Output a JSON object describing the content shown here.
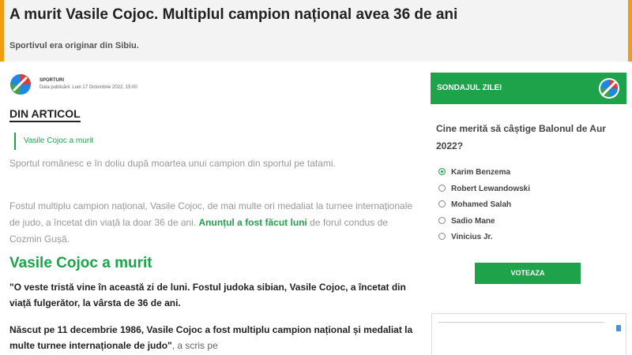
{
  "article": {
    "title": "A murit Vasile Cojoc. Multiplul campion național avea 36 de ani",
    "subtitle": "Sportivul era originar din Sibiu.",
    "author": "SPORTURI",
    "date": "Data publicării: Luni 17 Octombrie 2022, 15:00",
    "din_articol": "DIN ARTICOL",
    "toc_item": "Vasile Cojoc a murit",
    "p1": "Sportul românesc e în doliu după moartea unui campion din sportul pe tatami.",
    "p2_before": "Fostul multiplu campion național, Vasile Cojoc, de mai multe ori medaliat la turnee internaționale de judo, a încetat din viață la doar 36 de ani. ",
    "p2_link": "Anunțul a fost făcut luni",
    "p2_after": " de forul condus de Cozmin Gușă.",
    "h2": "Vasile Cojoc a murit",
    "q1": "\"O veste tristă vine în această zi de luni. Fostul judoka sibian, Vasile Cojoc, a încetat din viață fulgerător, la vârsta de 36 de ani.",
    "q2_bold": "Născut pe 11 decembrie 1986, Vasile Cojoc a fost multiplu campion național și medaliat la multe turnee internaționale de judo\"",
    "q2_tail": ", a scris pe"
  },
  "poll": {
    "header": "SONDAJUL ZILEI",
    "question": "Cine merită să câștige Balonul de Aur 2022?",
    "options": [
      "Karim Benzema",
      "Robert Lewandowski",
      "Mohamed Salah",
      "Sadio Mane",
      "Vinicius Jr."
    ],
    "selected_index": 0,
    "vote_label": "VOTEAZA"
  },
  "colors": {
    "accent_green": "#1fa34a",
    "accent_orange": "#f39c12",
    "logo_red": "#e53935",
    "logo_blue": "#1e88e5",
    "logo_green": "#43a047"
  }
}
